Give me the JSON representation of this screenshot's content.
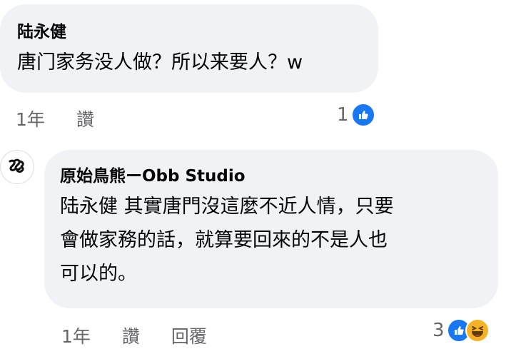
{
  "comments": [
    {
      "author": "陆永健",
      "text_lines": [
        "唐门家务没人做？所以来要人？w"
      ],
      "meta": {
        "time": "1年",
        "like_label": "讚"
      },
      "reactions": {
        "count": "1",
        "types": [
          "like-icon"
        ]
      }
    },
    {
      "author": "原始鳥熊ーObb Studio",
      "text_lines": [
        "陆永健 其實唐門沒這麼不近人情，只要",
        "會做家務的話，就算要回來的不是人也",
        "可以的。"
      ],
      "meta": {
        "time": "1年",
        "like_label": "讚",
        "reply_label": "回覆"
      },
      "reactions": {
        "count": "3",
        "types": [
          "like-icon",
          "haha-icon"
        ]
      }
    }
  ],
  "colors": {
    "bubble": "#f0f2f5",
    "like_blue": "#1877f2",
    "meta_gray": "#65676b",
    "haha_yellow": "#f7b125"
  }
}
